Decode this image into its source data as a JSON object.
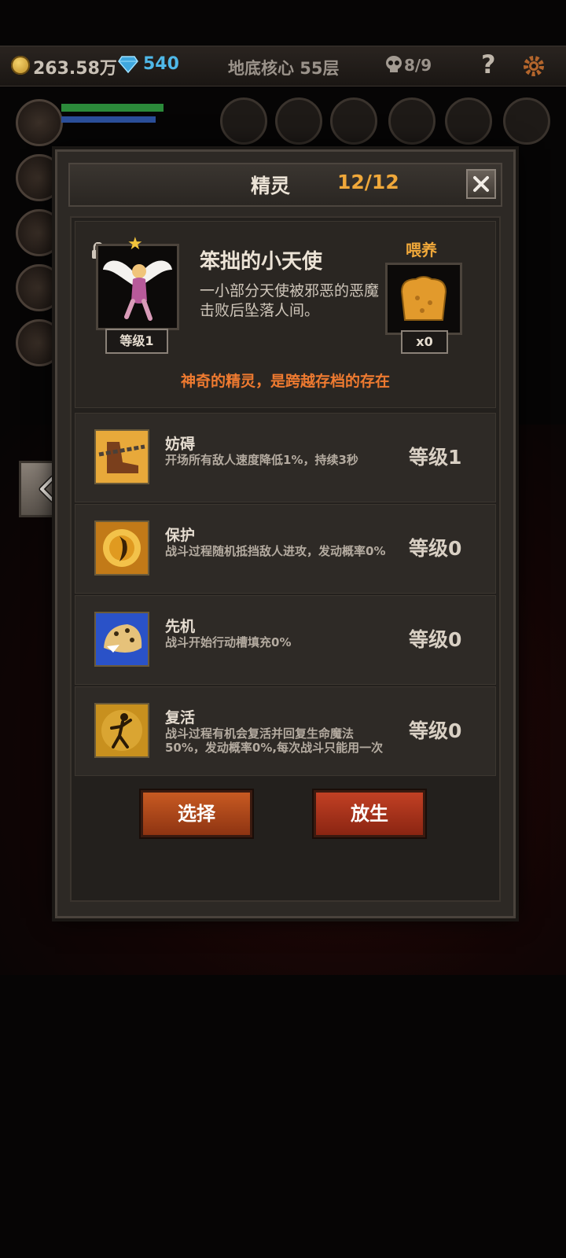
{
  "topbar": {
    "gold": "263.58万",
    "gems": "540",
    "floor": "地底核心 55层",
    "skulls": "8/9",
    "help": "?"
  },
  "modal": {
    "title": "精灵",
    "count": "12/12"
  },
  "pet": {
    "name": "笨拙的小天使",
    "description": "一小部分天使被邪恶的恶魔击败后坠落人间。",
    "level": "等级1",
    "feed_label": "喂养",
    "feed_count": "x0",
    "tagline": "神奇的精灵，是跨越存档的存在"
  },
  "skills": [
    {
      "name": "妨碍",
      "desc": "开场所有敌人速度降低1%，持续3秒",
      "level": "等级1",
      "icon": "chain-boot-icon"
    },
    {
      "name": "保护",
      "desc": "战斗过程随机抵挡敌人进攻，发动概率0%",
      "level": "等级0",
      "icon": "golden-shield-icon"
    },
    {
      "name": "先机",
      "desc": "战斗开始行动槽填充0%",
      "level": "等级0",
      "icon": "leopard-icon"
    },
    {
      "name": "复活",
      "desc": "战斗过程有机会复活并回复生命魔法50%，发动概率0%,每次战斗只能用一次",
      "level": "等级0",
      "icon": "revive-figure-icon"
    }
  ],
  "buttons": {
    "select": "选择",
    "release": "放生"
  },
  "colors": {
    "accent_orange": "#f0a83a",
    "tagline": "#ee7a30",
    "gem_blue": "#4fb8e8"
  }
}
